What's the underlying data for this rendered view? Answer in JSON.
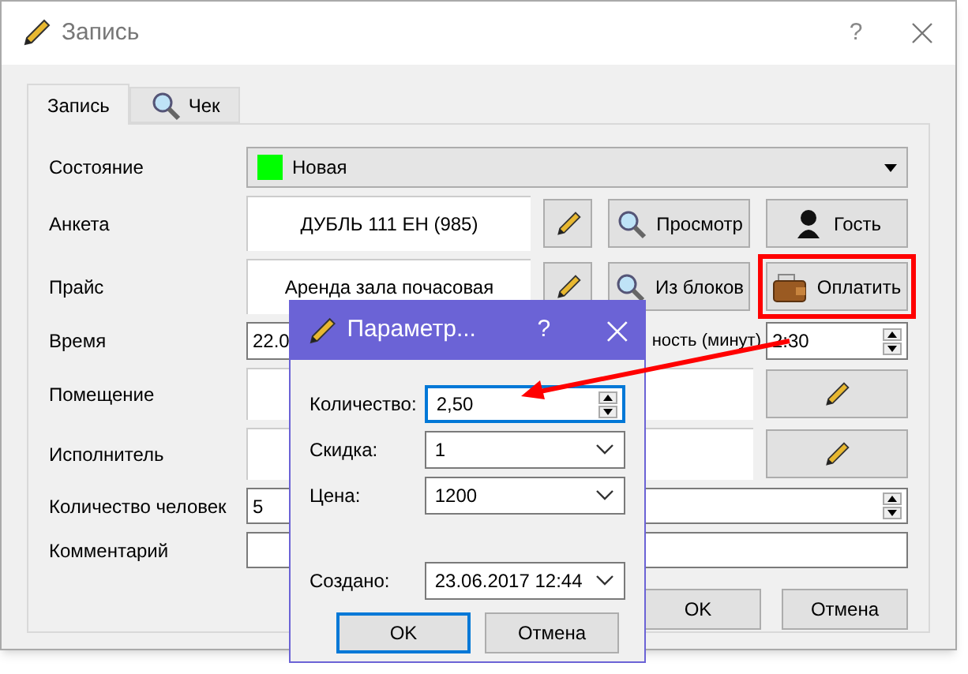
{
  "window": {
    "title": "Запись",
    "help": "?"
  },
  "tabs": [
    {
      "label": "Запись",
      "selected": true,
      "kind": "plain"
    },
    {
      "label": "Чек",
      "selected": false,
      "kind": "with_icon"
    }
  ],
  "rows": [
    {
      "kind": "status",
      "label": "Состояние",
      "value": "Новая",
      "color": "#00ff00"
    },
    {
      "kind": "lookup",
      "label": "Анкета",
      "value": "ДУБЛЬ 111 ЕН (985)",
      "buttons": [
        {
          "kind": "edit",
          "highlighted": false
        },
        {
          "kind": "view",
          "label": "Просмотр",
          "highlighted": false
        },
        {
          "kind": "guest",
          "label": "Гость",
          "highlighted": false
        }
      ]
    },
    {
      "kind": "lookup",
      "label": "Прайс",
      "value": "Аренда зала почасовая",
      "buttons": [
        {
          "kind": "edit",
          "highlighted": false
        },
        {
          "kind": "view",
          "label": "Из блоков",
          "highlighted": false
        },
        {
          "kind": "pay",
          "label": "Оплатить",
          "highlighted": true
        }
      ]
    },
    {
      "kind": "time",
      "label": "Время",
      "value": "22.0",
      "extra_label": "ность (минут)",
      "duration": "2:30"
    },
    {
      "kind": "picker",
      "label": "Помещение"
    },
    {
      "kind": "picker",
      "label": "Исполнитель"
    },
    {
      "kind": "spin",
      "label": "Количество человек",
      "value": "5"
    },
    {
      "kind": "text",
      "label": "Комментарий"
    }
  ],
  "buttons": [
    "OK",
    "Отмена"
  ],
  "dialog": {
    "title": "Параметр...",
    "help": "?",
    "fields": [
      {
        "kind": "spin",
        "label": "Количество:",
        "value": "2,50",
        "focused": true
      },
      {
        "kind": "combo",
        "label": "Скидка:",
        "value": "1",
        "focused": false
      },
      {
        "kind": "combo",
        "label": "Цена:",
        "value": "1200",
        "focused": false
      },
      {
        "kind": "combo",
        "label": "Создано:",
        "value": "23.06.2017 12:44",
        "focused": false
      }
    ],
    "buttons": [
      {
        "label": "OK",
        "default": true
      },
      {
        "label": "Отмена",
        "default": false
      }
    ]
  }
}
